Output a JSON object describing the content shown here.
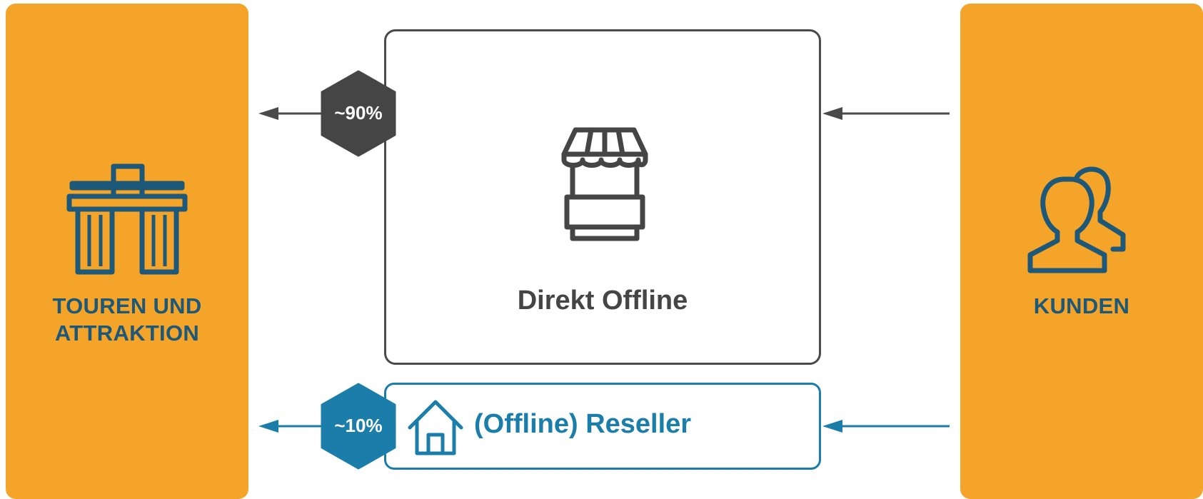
{
  "left_panel": {
    "label_line1": "TOUREN UND",
    "label_line2": "ATTRAKTION",
    "icon": "landmark-icon"
  },
  "right_panel": {
    "label": "KUNDEN",
    "icon": "users-icon"
  },
  "direct_offline": {
    "label": "Direkt Offline",
    "icon": "store-icon",
    "share": "~90%"
  },
  "reseller": {
    "label": "(Offline) Reseller",
    "icon": "house-icon",
    "share": "~10%"
  },
  "colors": {
    "panel": "#F5A42A",
    "panel_text": "#1D5878",
    "dark": "#454545",
    "blue": "#1A7DAA"
  }
}
